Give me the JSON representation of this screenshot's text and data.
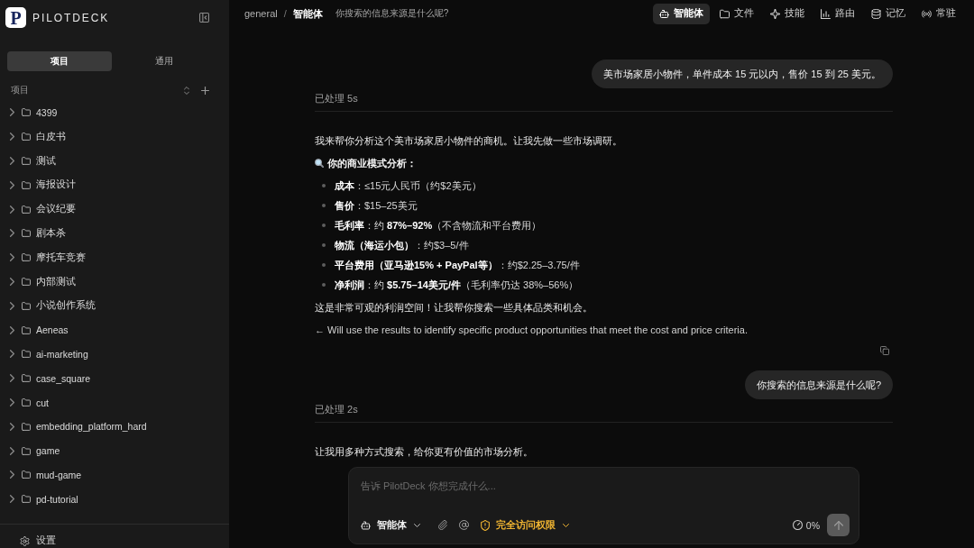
{
  "sidebar": {
    "logo": {
      "mark": "P",
      "name": "PILOTDECK"
    },
    "tabs": [
      {
        "label": "项目",
        "selected": true
      },
      {
        "label": "通用",
        "selected": false
      }
    ],
    "section": {
      "title": "项目"
    },
    "projects": [
      {
        "name": "4399",
        "expanded": false
      },
      {
        "name": "白皮书",
        "expanded": false
      },
      {
        "name": "测试",
        "expanded": false
      },
      {
        "name": "海报设计",
        "expanded": false
      },
      {
        "name": "会议纪要",
        "expanded": false
      },
      {
        "name": "剧本杀",
        "expanded": false
      },
      {
        "name": "摩托车竞赛",
        "expanded": false
      },
      {
        "name": "内部测试",
        "expanded": false
      },
      {
        "name": "小说创作系统",
        "expanded": false
      },
      {
        "name": "Aeneas",
        "expanded": false
      },
      {
        "name": "ai-marketing",
        "expanded": false
      },
      {
        "name": "case_square",
        "expanded": false
      },
      {
        "name": "cut",
        "expanded": false
      },
      {
        "name": "embedding_platform_hard",
        "expanded": false
      },
      {
        "name": "game",
        "expanded": false
      },
      {
        "name": "mud-game",
        "expanded": false
      },
      {
        "name": "pd-tutorial",
        "expanded": false
      }
    ],
    "footer": {
      "label": "设置"
    }
  },
  "header": {
    "breadcrumb": {
      "items": [
        "general",
        "智能体"
      ],
      "separator": "/"
    },
    "title": "你搜索的信息来源是什么呢?",
    "nav": [
      {
        "label": "智能体",
        "selected": true
      },
      {
        "label": "文件",
        "selected": false
      },
      {
        "label": "技能",
        "selected": false
      },
      {
        "label": "路由",
        "selected": false
      },
      {
        "label": "记忆",
        "selected": false
      },
      {
        "label": "常驻",
        "selected": false
      }
    ]
  },
  "chat": {
    "messages": [
      {
        "kind": "user",
        "text": "美市场家居小物件，单件成本 15 元以内，售价 15 到 25 美元。"
      },
      {
        "kind": "assistant",
        "status": "已处理 5s",
        "copyable": true,
        "blocks": [
          {
            "kind": "paragraph",
            "text": "我来帮你分析这个美市场家居小物件的商机。让我先做一些市场调研。"
          },
          {
            "kind": "heading",
            "text": "你的商业模式分析："
          },
          {
            "kind": "list",
            "items": [
              "**成本**：≤15元人民币（约$2美元）",
              "**售价**：$15–25美元",
              "**毛利率**：约 **87%–92%**（不含物流和平台费用）",
              "**物流（海运小包）**：约$3–5/件",
              "**平台费用（亚马逊15% + PayPal等）**：约$2.25–3.75/件",
              "**净利润**：约 **$5.75–14美元/件**（毛利率仍达 38%–56%）"
            ]
          },
          {
            "kind": "paragraph",
            "text": "这是非常可观的利润空间！让我帮你搜索一些具体品类和机会。"
          },
          {
            "kind": "note",
            "text": "← Will use the results to identify specific product opportunities that meet the cost and price criteria."
          }
        ]
      },
      {
        "kind": "user",
        "text": "你搜索的信息来源是什么呢?"
      },
      {
        "kind": "assistant",
        "status": "已处理 2s",
        "copyable": false,
        "blocks": [
          {
            "kind": "paragraph",
            "text": "让我用多种方式搜索，给你更有价值的市场分析。"
          }
        ]
      }
    ]
  },
  "composer": {
    "placeholder": "告诉 PilotDeck 你想完成什么...",
    "mode": "智能体",
    "permission": "完全访问权限",
    "usage": "0%",
    "send": {
      "disabled": true
    }
  }
}
